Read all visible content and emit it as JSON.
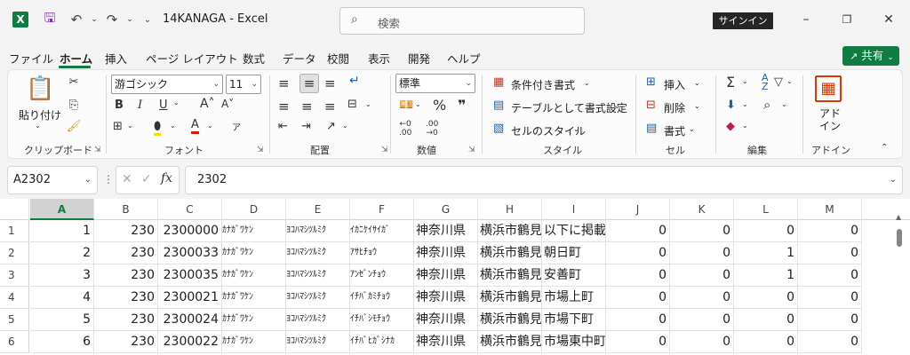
{
  "titlebar": {
    "title": "14KANAGA  -  Excel",
    "search_placeholder": "検索",
    "signin_label": "サインイン",
    "accent_color": "#107c41"
  },
  "tabs": [
    "ファイル",
    "ホーム",
    "挿入",
    "ページ レイアウト",
    "数式",
    "データ",
    "校閲",
    "表示",
    "開発",
    "ヘルプ"
  ],
  "active_tab": "ホーム",
  "share_label": "共有",
  "ribbon": {
    "clipboard": {
      "paste_label": "貼り付け",
      "group_label": "クリップボード"
    },
    "font": {
      "font_name": "游ゴシック",
      "font_size": "11",
      "group_label": "フォント"
    },
    "alignment": {
      "group_label": "配置"
    },
    "number": {
      "format": "標準",
      "group_label": "数値"
    },
    "styles": {
      "conditional_label": "条件付き書式",
      "table_label": "テーブルとして書式設定",
      "cellstyle_label": "セルのスタイル",
      "group_label": "スタイル"
    },
    "cells": {
      "insert_label": "挿入",
      "delete_label": "削除",
      "format_label": "書式",
      "group_label": "セル"
    },
    "editing": {
      "group_label": "編集"
    },
    "addins": {
      "addin_label": "アド\nイン",
      "group_label": "アドイン"
    }
  },
  "namebox": "A2302",
  "formula_value": "2302",
  "columns": [
    "A",
    "B",
    "C",
    "D",
    "E",
    "F",
    "G",
    "H",
    "I",
    "J",
    "K",
    "L",
    "M"
  ],
  "selected_column": "A",
  "rows": [
    {
      "num": "1",
      "cells": [
        "1",
        "230",
        "2300000",
        "ｶﾅｶﾞﾜｹﾝ",
        "ﾖｺﾊﾏｼﾂﾙﾐｸ",
        "ｲｶﾆｹｲｻｲｶﾞ",
        "神奈川県",
        "横浜市鶴見区",
        "以下に掲載",
        "0",
        "0",
        "0",
        "0"
      ]
    },
    {
      "num": "2",
      "cells": [
        "2",
        "230",
        "2300033",
        "ｶﾅｶﾞﾜｹﾝ",
        "ﾖｺﾊﾏｼﾂﾙﾐｸ",
        "ｱｻﾋﾁｮｳ",
        "神奈川県",
        "横浜市鶴見区",
        "朝日町",
        "0",
        "0",
        "1",
        "0"
      ]
    },
    {
      "num": "3",
      "cells": [
        "3",
        "230",
        "2300035",
        "ｶﾅｶﾞﾜｹﾝ",
        "ﾖｺﾊﾏｼﾂﾙﾐｸ",
        "ｱﾝｾﾞﾝﾁｮｳ",
        "神奈川県",
        "横浜市鶴見区",
        "安善町",
        "0",
        "0",
        "1",
        "0"
      ]
    },
    {
      "num": "4",
      "cells": [
        "4",
        "230",
        "2300021",
        "ｶﾅｶﾞﾜｹﾝ",
        "ﾖｺﾊﾏｼﾂﾙﾐｸ",
        "ｲﾁﾊﾞｶﾐﾁｮｳ",
        "神奈川県",
        "横浜市鶴見区",
        "市場上町",
        "0",
        "0",
        "0",
        "0"
      ]
    },
    {
      "num": "5",
      "cells": [
        "5",
        "230",
        "2300024",
        "ｶﾅｶﾞﾜｹﾝ",
        "ﾖｺﾊﾏｼﾂﾙﾐｸ",
        "ｲﾁﾊﾞｼﾓﾁｮｳ",
        "神奈川県",
        "横浜市鶴見区",
        "市場下町",
        "0",
        "0",
        "0",
        "0"
      ]
    },
    {
      "num": "6",
      "cells": [
        "6",
        "230",
        "2300022",
        "ｶﾅｶﾞﾜｹﾝ",
        "ﾖｺﾊﾏｼﾂﾙﾐｸ",
        "ｲﾁﾊﾞﾋｶﾞｼﾅｶ",
        "神奈川県",
        "横浜市鶴見区",
        "市場東中町",
        "0",
        "0",
        "0",
        "0"
      ]
    }
  ]
}
